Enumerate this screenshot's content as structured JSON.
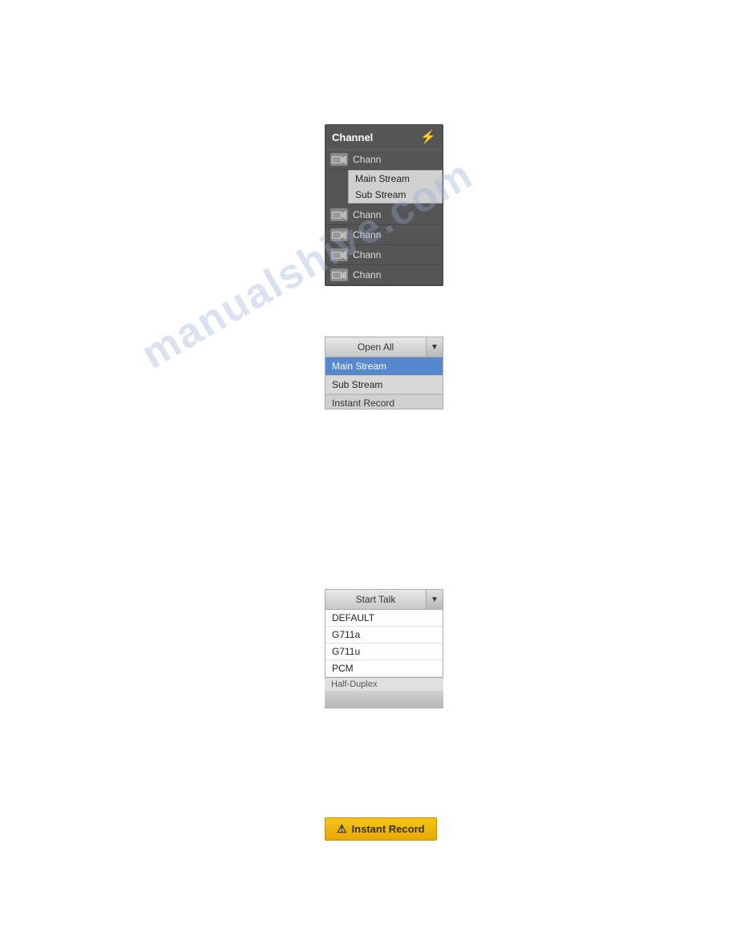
{
  "watermark": {
    "text": "manualshive.com"
  },
  "panel_channel": {
    "title": "Channel",
    "lightning_icon": "⚡",
    "items": [
      {
        "label": "Chann",
        "has_subdropdown": true
      },
      {
        "label": "Chann",
        "has_subdropdown": false
      },
      {
        "label": "Chann",
        "has_subdropdown": false
      },
      {
        "label": "Chann",
        "has_subdropdown": false
      },
      {
        "label": "Chann",
        "has_subdropdown": false
      }
    ],
    "subdropdown": {
      "items": [
        "Main Stream",
        "Sub Stream"
      ]
    }
  },
  "panel_openall": {
    "button_label": "Open All",
    "arrow": "▼",
    "dropdown_items": [
      {
        "label": "Main Stream",
        "active": true
      },
      {
        "label": "Sub Stream",
        "active": false
      }
    ],
    "partial_label": "Instant Record"
  },
  "panel_starttalk": {
    "button_label": "Start Talk",
    "arrow": "▼",
    "dropdown_items": [
      {
        "label": "DEFAULT"
      },
      {
        "label": "G711a"
      },
      {
        "label": "G711u"
      },
      {
        "label": "PCM"
      }
    ],
    "partial_label": "Half-Duplex"
  },
  "panel_instantrecord": {
    "icon": "⚠",
    "label": "Instant Record"
  }
}
